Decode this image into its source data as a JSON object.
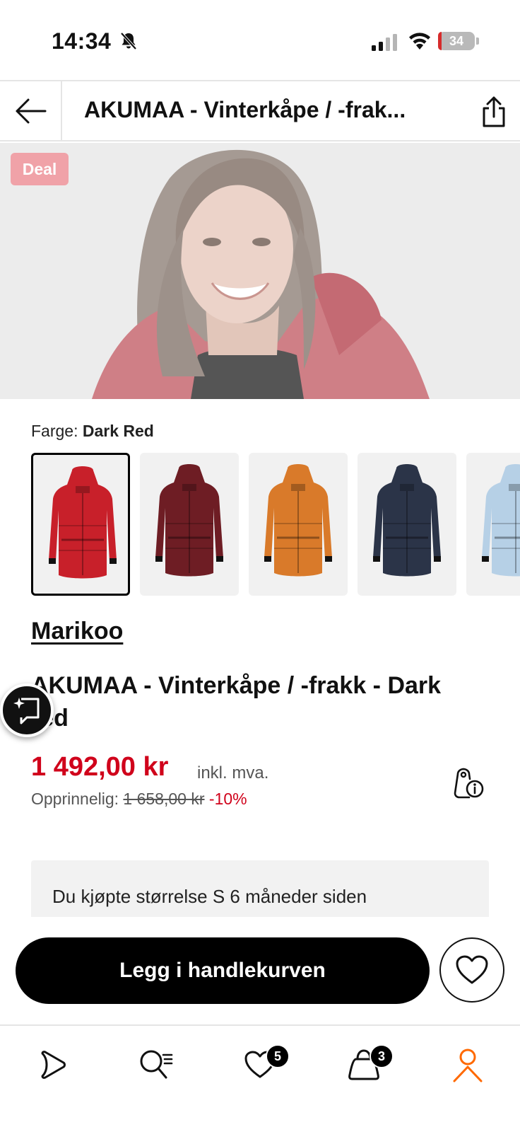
{
  "status_bar": {
    "time": "14:34",
    "battery": "34"
  },
  "header": {
    "title": "AKUMAA - Vinterkåpe / -frak..."
  },
  "hero": {
    "badge": "Deal"
  },
  "colors": {
    "label": "Farge:",
    "selected": "Dark Red",
    "options": [
      {
        "name": "Dark Red",
        "hex": "#c8202a",
        "selected": true
      },
      {
        "name": "Wine",
        "hex": "#6e1d24",
        "selected": false
      },
      {
        "name": "Orange",
        "hex": "#d97a2a",
        "selected": false
      },
      {
        "name": "Navy",
        "hex": "#2b3448",
        "selected": false
      },
      {
        "name": "Light Blue",
        "hex": "#b6d0e6",
        "selected": false
      }
    ]
  },
  "product": {
    "brand": "Marikoo",
    "title": "AKUMAA - Vinterkåpe / -frakk - Dark red",
    "price": "1 492,00 kr",
    "vat": "inkl. mva.",
    "original_label": "Opprinnelig:",
    "original_price": "1 658,00 kr",
    "discount": "-10%"
  },
  "purchase_info": "Du kjøpte størrelse S 6 måneder siden",
  "actions": {
    "add_to_cart": "Legg i handlekurven"
  },
  "tab_bar": {
    "items": [
      {
        "name": "play-icon",
        "badge": ""
      },
      {
        "name": "search-list-icon",
        "badge": ""
      },
      {
        "name": "heart-icon",
        "badge": "5"
      },
      {
        "name": "bag-icon",
        "badge": "3"
      },
      {
        "name": "profile-icon",
        "badge": ""
      }
    ],
    "active_color": "#ff6900"
  }
}
